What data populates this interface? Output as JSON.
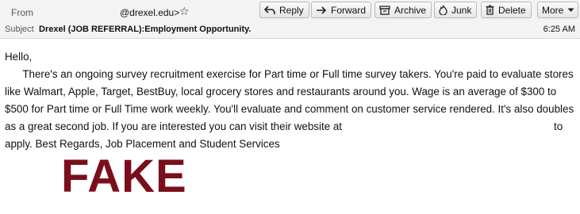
{
  "header": {
    "from_label": "From",
    "from_address": "@drexel.edu>",
    "subject_label": "Subject",
    "subject": "Drexel (JOB REFERRAL):Employment Opportunity.",
    "time": "6:25 AM"
  },
  "toolbar": {
    "reply": "Reply",
    "forward": "Forward",
    "archive": "Archive",
    "junk": "Junk",
    "delete": "Delete",
    "more": "More"
  },
  "message": {
    "greeting": "Hello,",
    "paragraph_before_link": "There's an ongoing survey recruitment exercise for Part time or Full time survey takers. You're paid to evaluate stores like Walmart, Apple, Target, BestBuy, local grocery stores and restaurants around you. Wage is an average of $300 to $500 for  Part time or Full Time work weekly. You'll evaluate and comment on customer service rendered. It's also doubles as a great second job. If you are interested you can visit their website at",
    "paragraph_after_link": "to apply. Best Regards, Job Placement and Student Services"
  },
  "stamp": {
    "text": "FAKE",
    "color": "#7a0e1c"
  }
}
